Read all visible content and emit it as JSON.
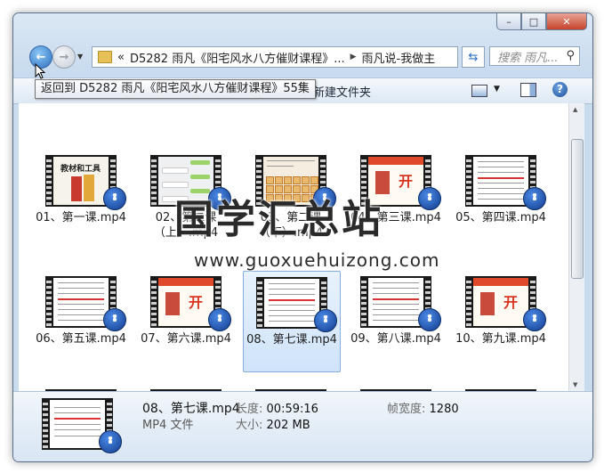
{
  "window": {
    "min_label": "–",
    "max_label": "□",
    "close_label": "✕"
  },
  "nav": {
    "back_icon": "back-arrow-icon",
    "forward_icon": "forward-arrow-icon",
    "chevron": "«",
    "path_part1": "D5282 雨凡《阳宅风水八方催财课程》...",
    "separator": "▶",
    "path_part2": "雨凡说-我做主",
    "search_placeholder": "搜索 雨凡...",
    "refresh_icon": "⇆"
  },
  "toolbar": {
    "tooltip": "返回到 D5282 雨凡《阳宅风水八方催财课程》55集",
    "new_folder": "新建文件夹",
    "help": "?"
  },
  "files": [
    {
      "name": "01、第一课.mp4",
      "thumb": "slide"
    },
    {
      "name": "02、第二课（上）.mp4",
      "thumb": "chat"
    },
    {
      "name": "03、第二课（下）.mp4",
      "thumb": "grid"
    },
    {
      "name": "04、第三课.mp4",
      "thumb": "red"
    },
    {
      "name": "05、第四课.mp4",
      "thumb": "doc"
    },
    {
      "name": "06、第五课.mp4",
      "thumb": "doc"
    },
    {
      "name": "07、第六课.mp4",
      "thumb": "red"
    },
    {
      "name": "08、第七课.mp4",
      "thumb": "doc",
      "selected": true
    },
    {
      "name": "09、第八课.mp4",
      "thumb": "doc"
    },
    {
      "name": "10、第九课.mp4",
      "thumb": "red"
    },
    {
      "name": "",
      "thumb": "doc"
    },
    {
      "name": "",
      "thumb": "doc"
    },
    {
      "name": "",
      "thumb": "yin"
    },
    {
      "name": "",
      "thumb": "doc"
    },
    {
      "name": "",
      "thumb": "doc"
    }
  ],
  "watermark": {
    "text": "国学汇总站",
    "url": "www.guoxuehuizong.com"
  },
  "details": {
    "name": "08、第七课.mp4",
    "type": "MP4 文件",
    "length_label": "长度:",
    "length_value": "00:59:16",
    "size_label": "大小:",
    "size_value": "202 MB",
    "width_label": "帧宽度:",
    "width_value": "1280"
  }
}
